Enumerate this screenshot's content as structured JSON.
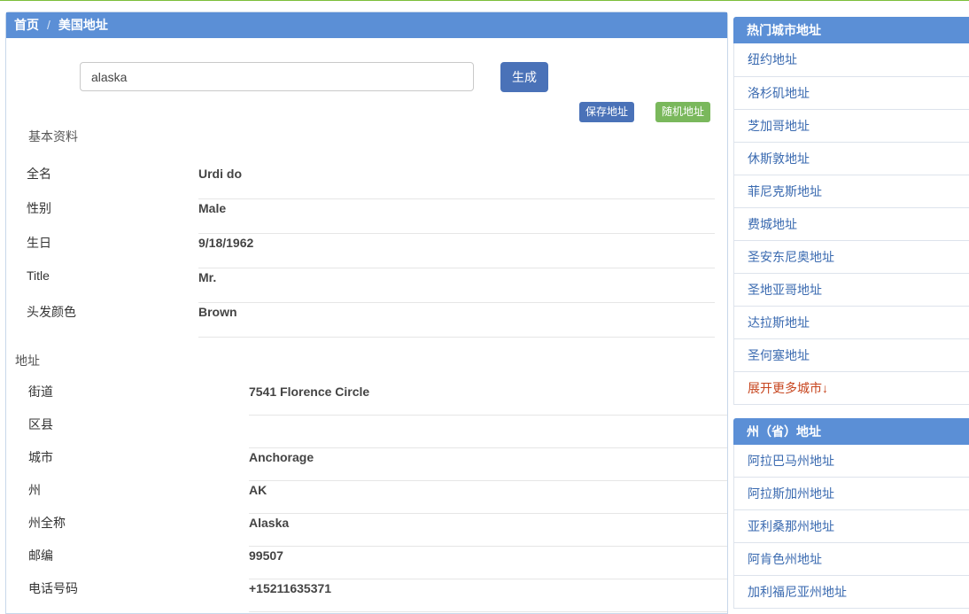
{
  "breadcrumb": {
    "home": "首页",
    "separator": "/",
    "current": "美国地址"
  },
  "search": {
    "value": "alaska"
  },
  "buttons": {
    "generate": "生成",
    "save": "保存地址",
    "random": "随机地址"
  },
  "basic": {
    "title": "基本资料",
    "rows": [
      {
        "label": "全名",
        "value": "Urdi do"
      },
      {
        "label": "性别",
        "value": "Male"
      },
      {
        "label": "生日",
        "value": "9/18/1962"
      },
      {
        "label": "Title",
        "value": "Mr."
      },
      {
        "label": "头发颜色",
        "value": "Brown"
      }
    ]
  },
  "address": {
    "title": "地址",
    "rows": [
      {
        "label": "街道",
        "value": "7541 Florence Circle"
      },
      {
        "label": "区县",
        "value": ""
      },
      {
        "label": "城市",
        "value": "Anchorage"
      },
      {
        "label": "州",
        "value": "AK"
      },
      {
        "label": "州全称",
        "value": "Alaska"
      },
      {
        "label": "邮编",
        "value": "99507"
      },
      {
        "label": "电话号码",
        "value": "+15211635371"
      }
    ]
  },
  "sidebar": {
    "cities": {
      "title": "热门城市地址",
      "items": [
        "纽约地址",
        "洛杉矶地址",
        "芝加哥地址",
        "休斯敦地址",
        "菲尼克斯地址",
        "费城地址",
        "圣安东尼奥地址",
        "圣地亚哥地址",
        "达拉斯地址",
        "圣何塞地址"
      ],
      "more": "展开更多城市↓"
    },
    "states": {
      "title": "州（省）地址",
      "items": [
        "阿拉巴马州地址",
        "阿拉斯加州地址",
        "亚利桑那州地址",
        "阿肯色州地址",
        "加利福尼亚州地址"
      ]
    }
  },
  "colors": {
    "header": "#5b8fd6",
    "primary_button": "#4a72b8",
    "random_button": "#7ab85c",
    "link": "#3a6ab0",
    "more_link": "#c7451e"
  }
}
